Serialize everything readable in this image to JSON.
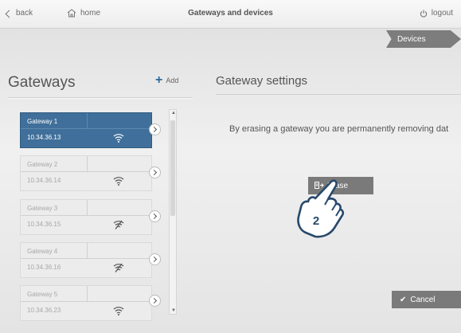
{
  "topbar": {
    "back_label": "back",
    "home_label": "home",
    "title": "Gateways and devices",
    "logout_label": "logout"
  },
  "devices_tab": "Devices",
  "gateways": {
    "title": "Gateways",
    "add_label": "Add",
    "items": [
      {
        "name": "Gateway 1",
        "ip": "10.34.36.13",
        "selected": true,
        "signal": "strong"
      },
      {
        "name": "Gateway 2",
        "ip": "10.34.36.14",
        "selected": false,
        "signal": "strong"
      },
      {
        "name": "Gateway 3",
        "ip": "10.34.36.15",
        "selected": false,
        "signal": "none"
      },
      {
        "name": "Gateway 4",
        "ip": "10.34.36.16",
        "selected": false,
        "signal": "none"
      },
      {
        "name": "Gateway 5",
        "ip": "10.34.36.23",
        "selected": false,
        "signal": "strong"
      }
    ]
  },
  "settings": {
    "title": "Gateway settings",
    "message": "By erasing a gateway you are permanently removing dat",
    "erase_label": "Erase",
    "cancel_label": "Cancel"
  },
  "callout_number": "2",
  "colors": {
    "selected": "#3f6f9a",
    "accent": "#2d6a9a",
    "button": "#7a7a7a"
  }
}
